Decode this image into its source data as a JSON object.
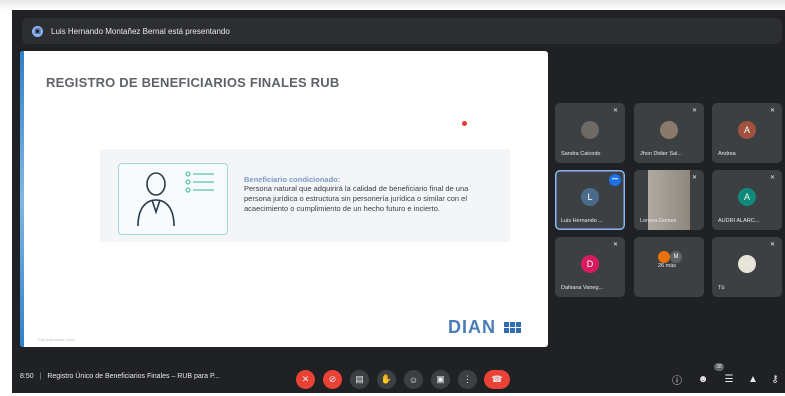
{
  "presenter": {
    "text": "Luis Hernando Montañez Bernal está presentando",
    "icon": "present-screen-icon"
  },
  "slide": {
    "title": "REGISTRO DE BENEFICIARIOS FINALES RUB",
    "definition_title": "Beneficiario condicionado:",
    "definition_text": "Persona natural que adquirirá la calidad de beneficiario final de una persona jurídica o estructura sin personería jurídica o similar con el acaecimiento o cumplimiento de un hecho futuro e incierto.",
    "logo_text": "DIAN",
    "footer": "Sub Impuestos Guía"
  },
  "participants": [
    {
      "name": "Sandra Caicedo",
      "type": "photo",
      "initial": ""
    },
    {
      "name": "Jhon Didier Sal...",
      "type": "photo",
      "initial": ""
    },
    {
      "name": "Andrea",
      "type": "initial",
      "initial": "A",
      "color": "#a0523f"
    },
    {
      "name": "Luis Hernando ...",
      "type": "initial",
      "initial": "L",
      "color": "#4a6c8a"
    },
    {
      "name": "Lorena Gomez",
      "type": "video",
      "initial": ""
    },
    {
      "name": "AUDRI ALARC...",
      "type": "initial",
      "initial": "A",
      "color": "#0f8a7a"
    },
    {
      "name": "Dahiana Vaneg...",
      "type": "initial",
      "initial": "D",
      "color": "#d81b60"
    },
    {
      "name": "26 más",
      "type": "group",
      "initial": "M"
    },
    {
      "name": "Tú",
      "type": "photo",
      "initial": ""
    }
  ],
  "bottom": {
    "time": "8:50",
    "separator": "|",
    "meeting_title": "Registro Único de Beneficiarios Finales – RUB para P...",
    "participant_count": "38"
  },
  "colors": {
    "background": "#202124",
    "tile": "#3c4043",
    "danger": "#ea4335",
    "accent": "#8ab4f8"
  }
}
